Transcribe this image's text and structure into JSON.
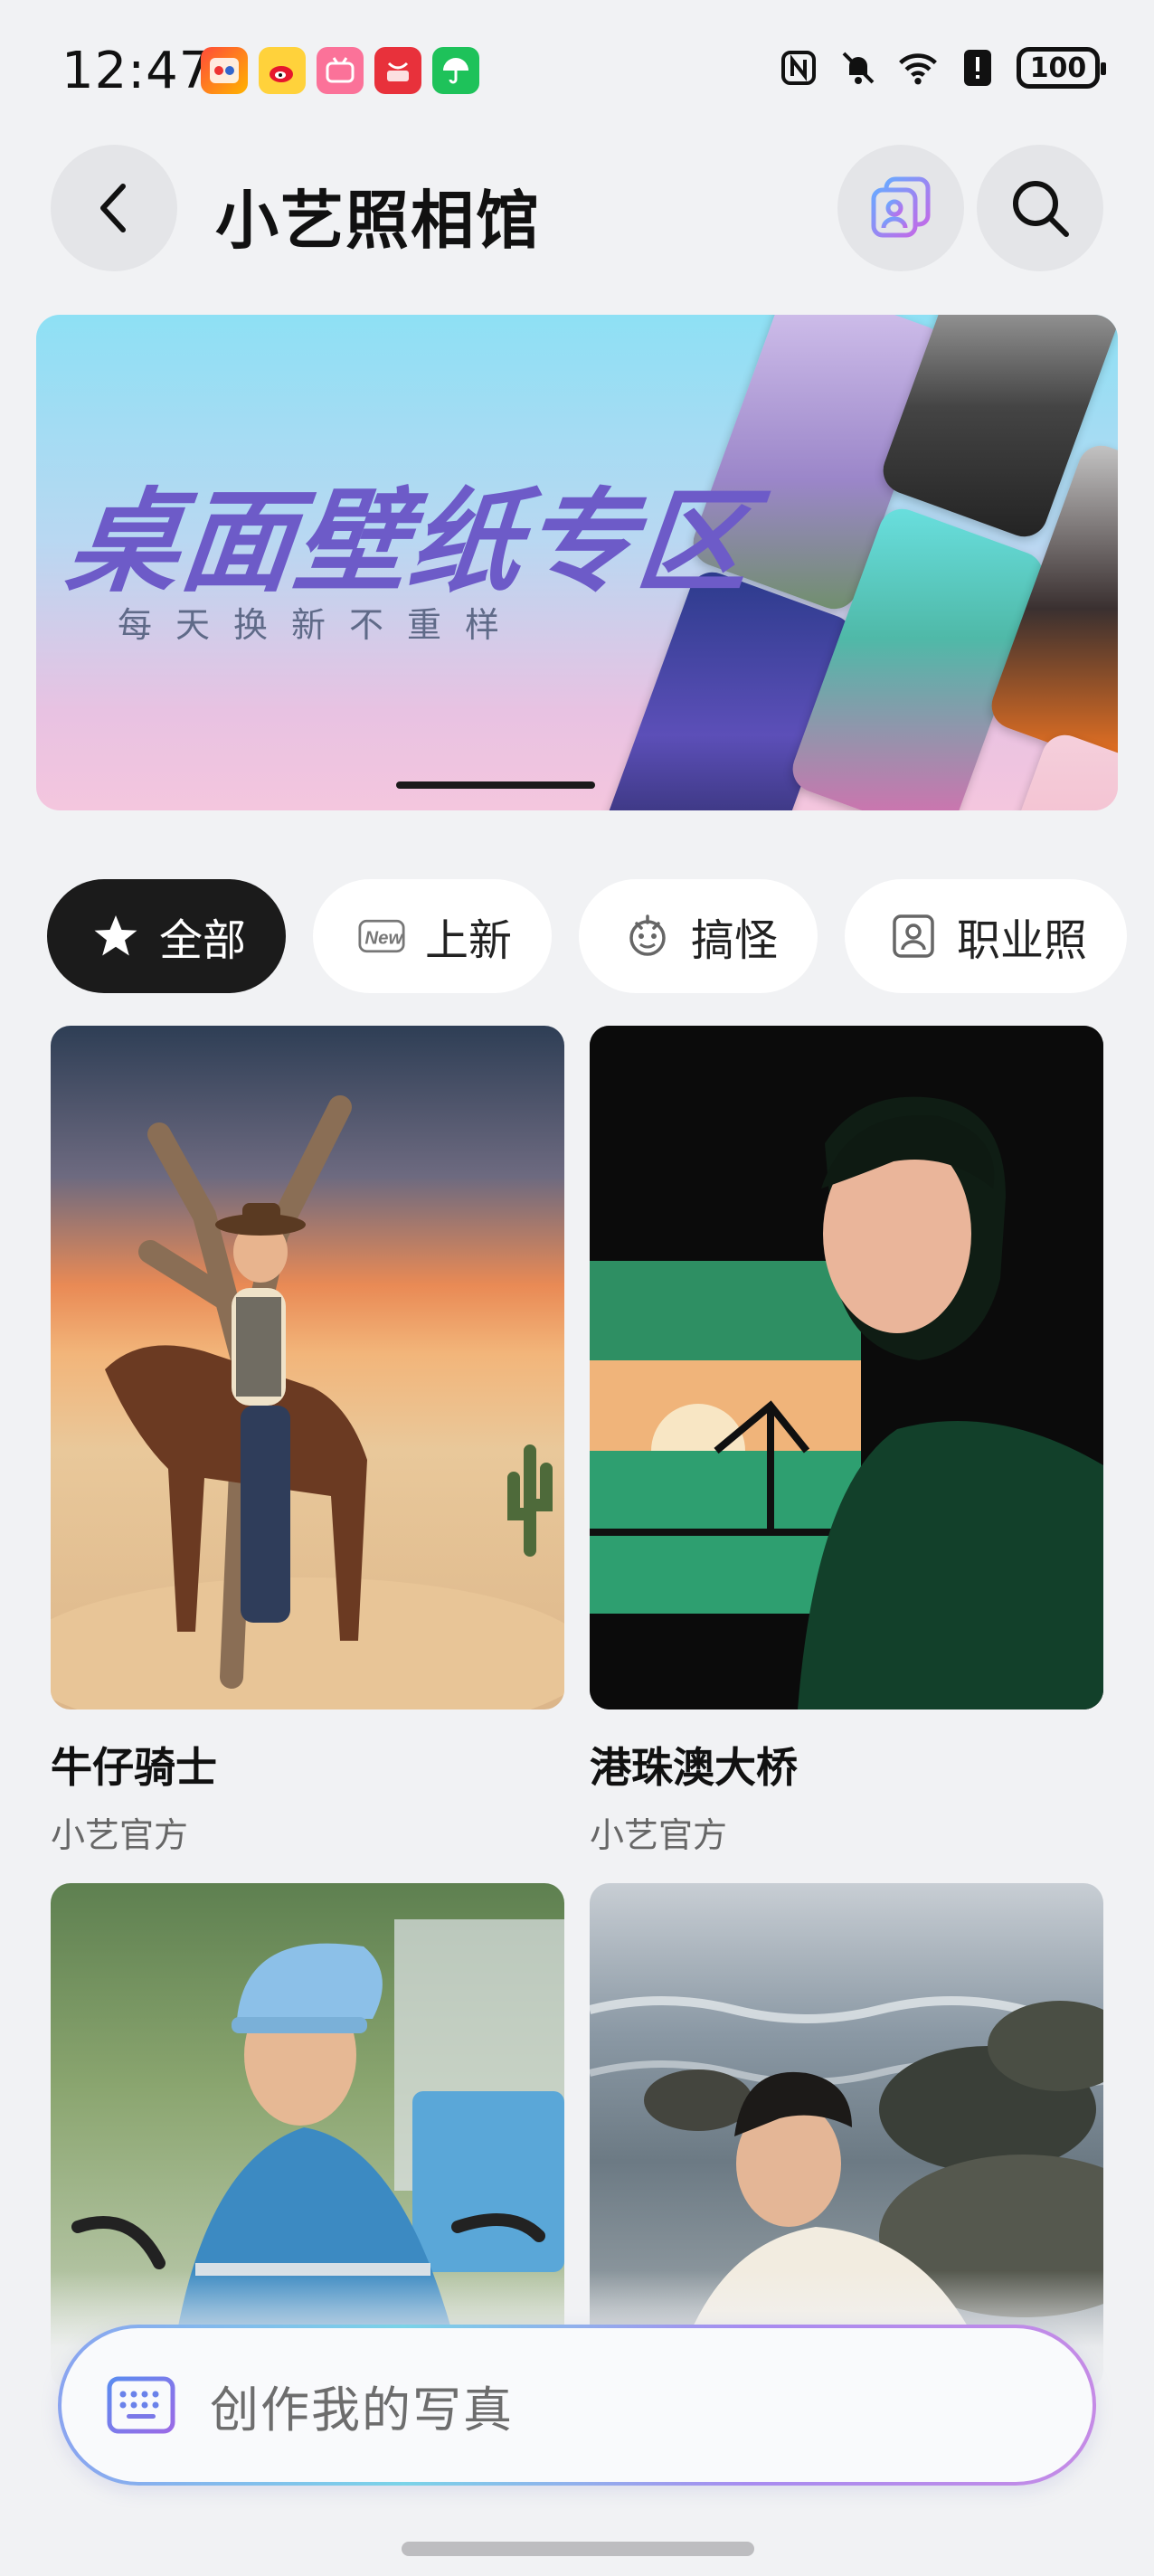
{
  "status_bar": {
    "time": "12:47",
    "battery": "100",
    "apps": [
      "app-1",
      "weibo-icon",
      "bilibili-icon",
      "app-gallery-icon",
      "umbrella-icon"
    ]
  },
  "header": {
    "title": "小艺照相馆"
  },
  "banner": {
    "title": "桌面壁纸专区",
    "subtitle": "每天换新不重样"
  },
  "tabs": [
    {
      "label": "全部",
      "icon": "star-icon",
      "active": true
    },
    {
      "label": "上新",
      "icon": "new-icon",
      "active": false
    },
    {
      "label": "搞怪",
      "icon": "funny-face-icon",
      "active": false
    },
    {
      "label": "职业照",
      "icon": "id-photo-icon",
      "active": false
    }
  ],
  "cards": [
    {
      "title": "牛仔骑士",
      "author": "小艺官方"
    },
    {
      "title": "港珠澳大桥",
      "author": "小艺官方"
    },
    {
      "title": "",
      "author": ""
    },
    {
      "title": "",
      "author": ""
    }
  ],
  "input": {
    "placeholder": "创作我的写真"
  },
  "colors": {
    "background": "#f1f2f4",
    "active_tab": "#1b1b1b",
    "banner_title": "#6d5bc8"
  }
}
